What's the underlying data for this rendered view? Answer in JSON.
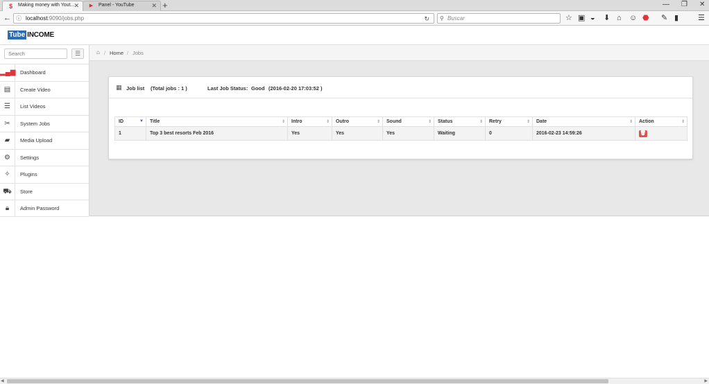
{
  "browser": {
    "tabs": [
      {
        "title": "Making money with Yout...",
        "favicon": "$",
        "favicon_color": "#d9363e",
        "active": true
      },
      {
        "title": "Panel - YouTube",
        "favicon": "▶",
        "favicon_color": "#e52d27",
        "active": false
      }
    ],
    "url_host": "localhost",
    "url_path": ":9090/jobs.php",
    "search_placeholder": "Buscar"
  },
  "app": {
    "logo_part1": "Tube",
    "logo_part2": "INCOME",
    "accent": "#2a6cb5"
  },
  "sidebar": {
    "search_placeholder": "Search",
    "items": [
      {
        "label": "Dashboard",
        "icon": "bar-chart-icon"
      },
      {
        "label": "Create Video",
        "icon": "film-icon"
      },
      {
        "label": "List Videos",
        "icon": "list-icon"
      },
      {
        "label": "System Jobs",
        "icon": "tools-icon"
      },
      {
        "label": "Media Upload",
        "icon": "folder-upload-icon"
      },
      {
        "label": "Settings",
        "icon": "gears-icon"
      },
      {
        "label": "Plugins",
        "icon": "magic-wand-icon"
      },
      {
        "label": "Store",
        "icon": "cart-icon"
      },
      {
        "label": "Admin Password",
        "icon": "lock-icon"
      }
    ]
  },
  "breadcrumb": {
    "home": "Home",
    "current": "Jobs"
  },
  "panel": {
    "title": "Job list",
    "total": "(Total jobs : 1 )",
    "status_label": "Last Job Status:",
    "status_value": "Good",
    "status_time": "(2016-02-20 17:03:52 )"
  },
  "table": {
    "columns": [
      "ID",
      "Title",
      "Intro",
      "Outro",
      "Sound",
      "Status",
      "Retry",
      "Date",
      "Action"
    ],
    "rows": [
      {
        "id": "1",
        "title": "Top 3 best resorts Feb 2016",
        "intro": "Yes",
        "outro": "Yes",
        "sound": "Yes",
        "status": "Waiting",
        "retry": "0",
        "date": "2016-02-23 14:59:26"
      }
    ]
  }
}
